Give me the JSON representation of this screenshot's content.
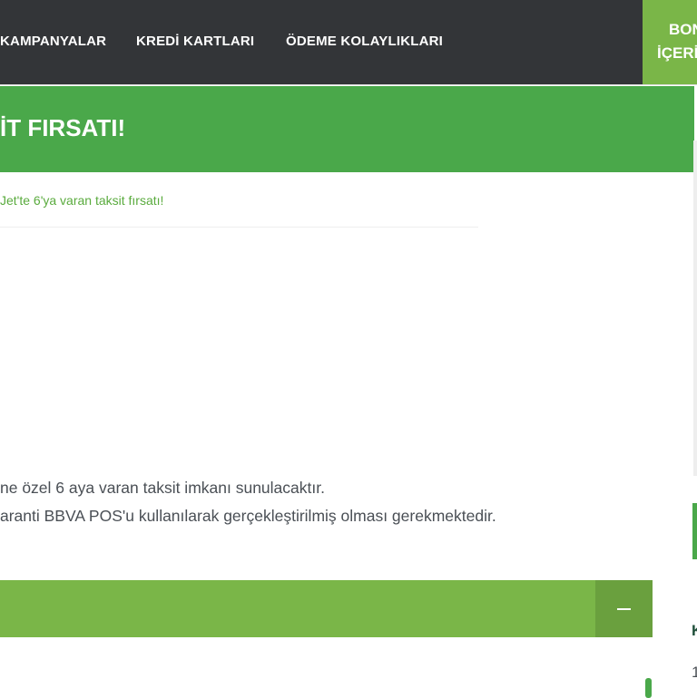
{
  "nav": {
    "items": [
      "KAMPANYALAR",
      "KREDİ KARTLARI",
      "ÖDEME KOLAYLIKLARI"
    ],
    "bonus_line1": "BON",
    "bonus_line2": "İÇERİ"
  },
  "hero": {
    "title": "İT FIRSATI!"
  },
  "breadcrumb": {
    "current": "Jet'te 6'ya varan taksit fırsatı!"
  },
  "content": {
    "lines": [
      "ne özel 6 aya varan taksit imkanı sunulacaktır.",
      "aranti BBVA POS'u kullanılarak gerçekleştirilmiş olması gerekmektedir."
    ]
  },
  "sidebar": {
    "char1": "K",
    "char2": "1"
  },
  "colors": {
    "nav_bg": "#333538",
    "hero_green": "#4aa84a",
    "accent_green": "#7ab648",
    "text": "#4a4f55"
  }
}
